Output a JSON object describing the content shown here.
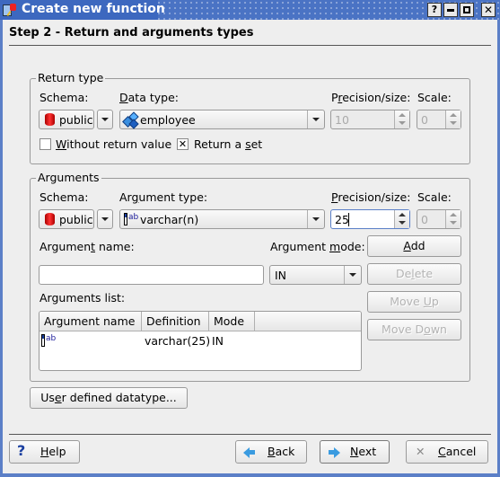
{
  "window": {
    "title": "Create new function",
    "controls": {
      "help": "?",
      "minimize": "▬",
      "maximize": "□",
      "close": "✕"
    }
  },
  "step_title": "Step 2 - Return and arguments types",
  "return_type": {
    "group_label": "Return type",
    "schema_label": "Schema:",
    "data_type_label_pre": "",
    "data_type_label_u": "D",
    "data_type_label_post": "ata type:",
    "precision_label_pre": "P",
    "precision_label_u": "r",
    "precision_label_post": "ecision/size:",
    "scale_label": "Scale:",
    "schema_value": "public",
    "data_type_value": "employee",
    "precision_value": "10",
    "scale_value": "0",
    "without_return_pre": "",
    "without_return_u": "W",
    "without_return_post": "ithout return value",
    "without_return_checked": false,
    "return_set_pre": "Return a ",
    "return_set_u": "s",
    "return_set_post": "et",
    "return_set_checked": true,
    "check_mark": "✕"
  },
  "arguments": {
    "group_label": "Arguments",
    "schema_label": "Schema:",
    "arg_type_label_pre": "Ar",
    "arg_type_label_u": "g",
    "arg_type_label_post": "ument type:",
    "precision_label_u": "P",
    "precision_label_post": "recision/size:",
    "scale_label": "Scale:",
    "schema_value": "public",
    "arg_type_value": "varchar(n)",
    "precision_value": "25",
    "scale_value": "0",
    "arg_name_label_pre": "Argumen",
    "arg_name_label_u": "t",
    "arg_name_label_post": " name:",
    "arg_name_value": "",
    "arg_mode_label_pre": "Argument ",
    "arg_mode_label_u": "m",
    "arg_mode_label_post": "ode:",
    "arg_mode_value": "IN",
    "list_label": "Arguments list:",
    "columns": [
      "Argument name",
      "Definition",
      "Mode"
    ],
    "rows": [
      {
        "name": "",
        "definition": "varchar(25)",
        "mode": "IN"
      }
    ],
    "buttons": {
      "add_u": "A",
      "add_post": "dd",
      "delete_pre": "De",
      "delete_u": "l",
      "delete_post": "ete",
      "move_up_pre": "Move ",
      "move_up_u": "U",
      "move_up_post": "p",
      "move_down_pre": "Move D",
      "move_down_u": "o",
      "move_down_post": "wn"
    }
  },
  "user_defined": {
    "pre": "Us",
    "u": "e",
    "post": "r defined datatype..."
  },
  "footer": {
    "help_u": "H",
    "help_post": "elp",
    "back_u": "B",
    "back_post": "ack",
    "next_u": "N",
    "next_post": "ext",
    "cancel_u": "C",
    "cancel_post": "ancel",
    "help_icon": "?",
    "cancel_icon": "✕"
  },
  "colors": {
    "titlebar": "#4a73c4",
    "window_border": "#5b7fc7",
    "background": "#eeeeee"
  }
}
